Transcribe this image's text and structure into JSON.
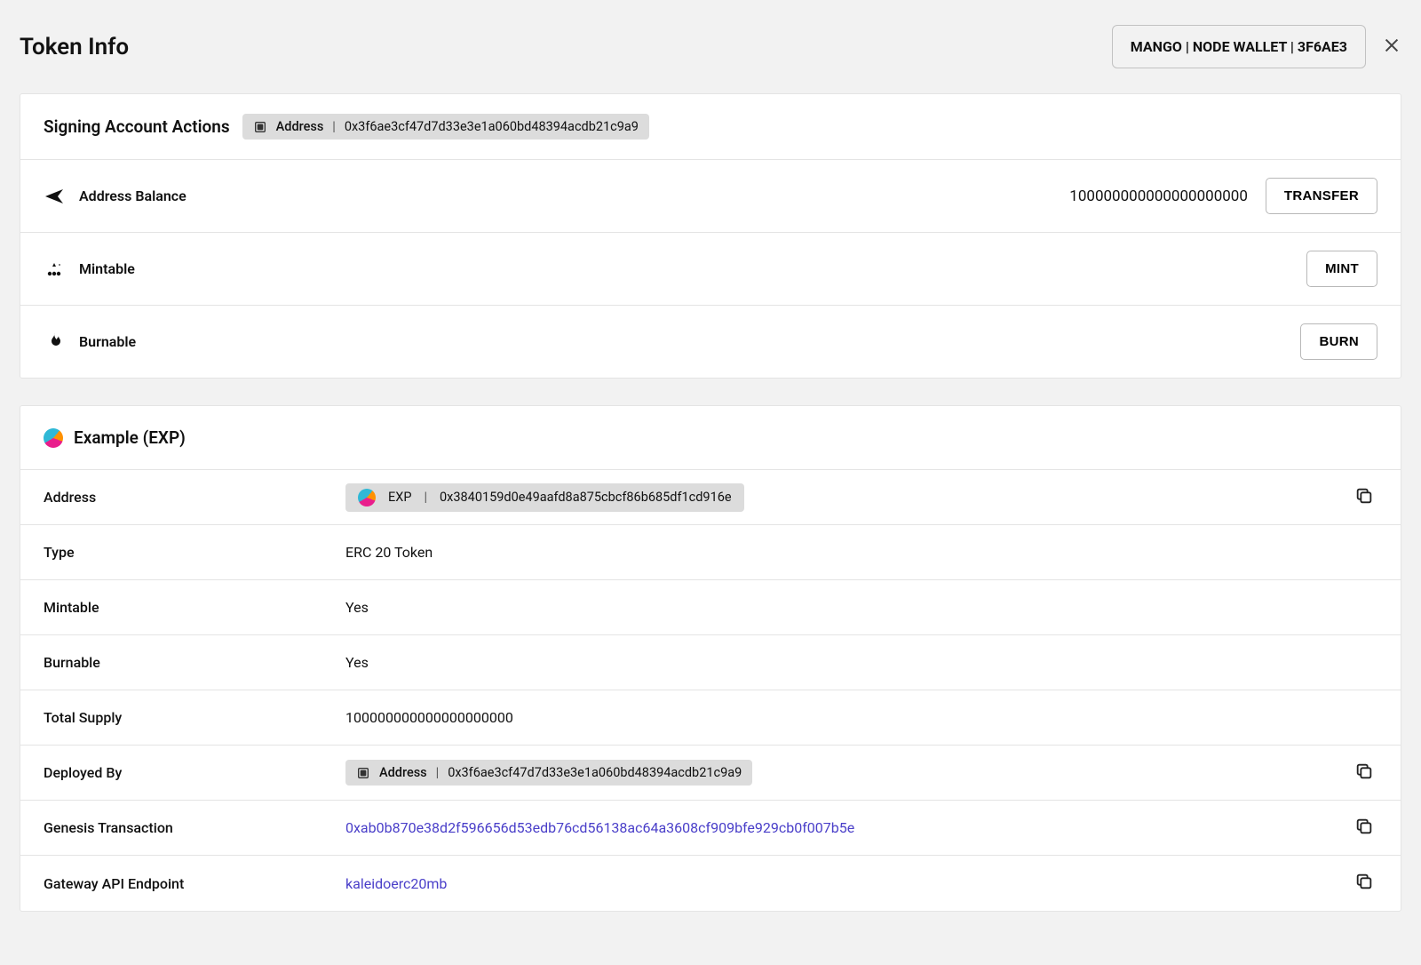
{
  "header": {
    "title": "Token Info",
    "wallet_label": "MANGO | NODE WALLET | 3F6AE3"
  },
  "signing": {
    "title": "Signing Account Actions",
    "address_label": "Address",
    "address_value": "0x3f6ae3cf47d7d33e3e1a060bd48394acdb21c9a9",
    "rows": {
      "balance_label": "Address Balance",
      "balance_value": "100000000000000000000",
      "transfer_btn": "TRANSFER",
      "mintable_label": "Mintable",
      "mint_btn": "MINT",
      "burnable_label": "Burnable",
      "burn_btn": "BURN"
    }
  },
  "token": {
    "title": "Example (EXP)",
    "details": {
      "address_label": "Address",
      "address_chip_symbol": "EXP",
      "address_chip_value": "0x3840159d0e49aafd8a875cbcf86b685df1cd916e",
      "type_label": "Type",
      "type_value": "ERC 20 Token",
      "mintable_label": "Mintable",
      "mintable_value": "Yes",
      "burnable_label": "Burnable",
      "burnable_value": "Yes",
      "supply_label": "Total Supply",
      "supply_value": "100000000000000000000",
      "deployed_label": "Deployed By",
      "deployed_chip_label": "Address",
      "deployed_chip_value": "0x3f6ae3cf47d7d33e3e1a060bd48394acdb21c9a9",
      "genesis_label": "Genesis Transaction",
      "genesis_value": "0xab0b870e38d2f596656d53edb76cd56138ac64a3608cf909bfe929cb0f007b5e",
      "gateway_label": "Gateway API Endpoint",
      "gateway_value": "kaleidoerc20mb"
    }
  }
}
